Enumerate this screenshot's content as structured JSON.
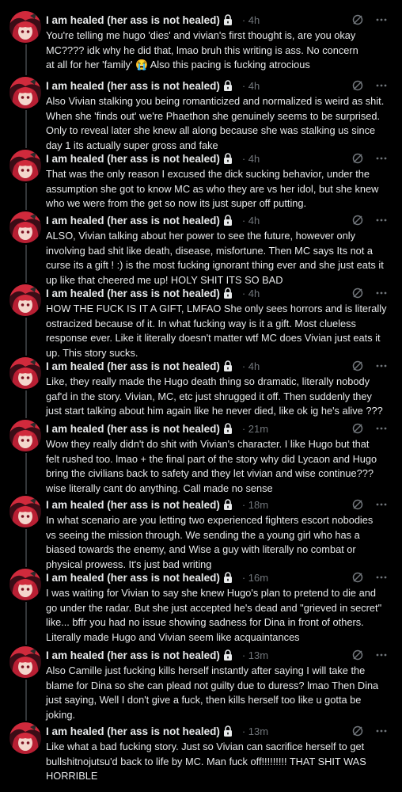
{
  "thread": {
    "author_name": "I am healed (her ass is not healed)",
    "posts": [
      {
        "time": "· 4h",
        "text": "You're telling me hugo 'dies' and vivian's first thought is, are you okay\nMC???? idk why he did that, lmao bruh this writing is ass. No concern\nat all for her 'family' 😭 Also this pacing is fucking atrocious"
      },
      {
        "time": "· 4h",
        "text": "Also Vivian stalking you being romanticized and normalized is weird as shit.\nWhen she 'finds out' we're Phaethon she genuinely seems to be surprised.\nOnly to reveal later she knew all along because she was stalking us since\nday 1 its actually super gross and fake"
      },
      {
        "time": "· 4h",
        "text": "That was the only reason I excused the dick sucking behavior, under the\nassumption she got to know MC as who they are vs her idol, but she knew\nwho we were from the get so now its just super off putting."
      },
      {
        "time": "· 4h",
        "text": "ALSO, Vivian talking about her power to see the future, however only\ninvolving bad shit like death, disease, misfortune. Then MC says Its not a\ncurse its a gift ! :) is the most fucking ignorant thing ever and she just eats it\nup like that cheered me up! HOLY SHIT ITS SO BAD"
      },
      {
        "time": "· 4h",
        "text": "HOW THE FUCK IS IT A GIFT, LMFAO She only sees horrors and is literally\nostracized because of it. In what fucking way is it a gift. Most clueless\nresponse ever. Like it literally doesn't matter wtf MC does Vivian just eats it\nup. This story sucks."
      },
      {
        "time": "· 4h",
        "text": "Like, they really made the Hugo death thing so dramatic, literally nobody\ngaf'd in the story. Vivian, MC, etc just shrugged it off. Then suddenly they\njust start talking about him again like he never died, like ok ig he's alive ???"
      },
      {
        "time": "· 21m",
        "text": "Wow they really didn't do shit with Vivian's character. I like Hugo but that\nfelt rushed too. lmao + the final part of the story why did Lycaon and Hugo\nbring the civilians back to safety and they let vivian and wise continue???\nwise literally cant do anything. Call made no sense"
      },
      {
        "time": "· 18m",
        "text": "In what scenario are you letting two experienced fighters escort nobodies\nvs seeing the mission through. We sending the a young girl who has a\nbiased towards the enemy, and Wise a guy with literally no combat or\nphysical prowess. It's just bad writing"
      },
      {
        "time": "· 16m",
        "text": "I was waiting for Vivian to say she knew Hugo's plan to pretend to die and\ngo under the radar. But she just accepted he's dead and \"grieved in secret\"\nlike... bffr you had no issue showing sadness for Dina in front of others.\nLiterally made Hugo and Vivian seem like acquaintances"
      },
      {
        "time": "· 13m",
        "text": "Also Camille just fucking kills herself instantly after saying I will take the\nblame for Dina so she can plead not guilty due to duress? lmao Then Dina\njust saying, Well I don't give a fuck, then kills herself too like u gotta be\njoking."
      },
      {
        "time": "· 13m",
        "text": "Like what a bad fucking story. Just so Vivian can sacrifice herself to get\nbullshitnojutsu'd back to life by MC. Man fuck off!!!!!!!!! THAT SHIT WAS\nHORRIBLE"
      }
    ]
  },
  "icons": {
    "lock": "lock-icon",
    "grok": "grok-icon",
    "more": "more-icon"
  },
  "colors": {
    "background": "#000000",
    "text": "#e7e9ea",
    "muted": "#71767b",
    "rail": "#333639",
    "avatar_red": "#d02a3c"
  }
}
